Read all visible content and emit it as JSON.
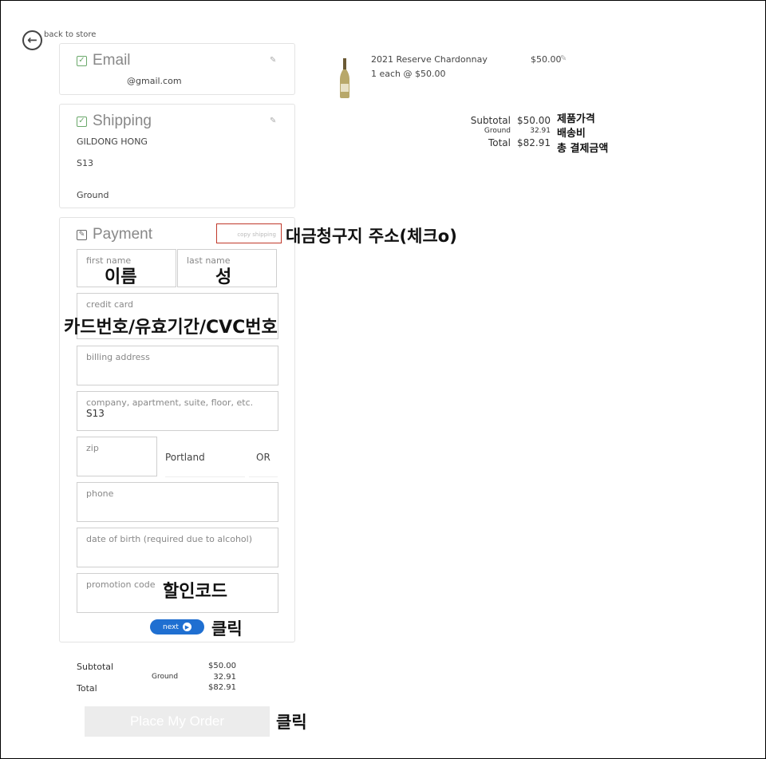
{
  "nav": {
    "back_label": "back to store"
  },
  "email": {
    "title": "Email",
    "value": "@gmail.com"
  },
  "shipping": {
    "title": "Shipping",
    "name": "GILDONG HONG",
    "address": "S13",
    "method": "Ground"
  },
  "payment": {
    "title": "Payment",
    "copy_shipping": "copy shipping",
    "first_name_label": "first name",
    "last_name_label": "last name",
    "credit_card_label": "credit card",
    "billing_address_label": "billing address",
    "company_label": "company, apartment, suite, floor, etc.",
    "company_value": "S13",
    "zip_label": "zip",
    "city_value": "Portland",
    "state_value": "OR",
    "phone_label": "phone",
    "dob_label": "date of birth (required due to alcohol)",
    "promo_label": "promotion code",
    "next_label": "next"
  },
  "product": {
    "name": "2021 Reserve Chardonnay",
    "price": "$50.00",
    "qty_line": "1 each @ $50.00"
  },
  "top_summary": {
    "subtotal_label": "Subtotal",
    "subtotal_value": "$50.00",
    "ground_label": "Ground",
    "ground_value": "32.91",
    "total_label": "Total",
    "total_value": "$82.91"
  },
  "bottom_summary": {
    "subtotal_label": "Subtotal",
    "subtotal_value": "$50.00",
    "ground_label": "Ground",
    "ground_value": "32.91",
    "total_label": "Total",
    "total_value": "$82.91"
  },
  "order_button": "Place My Order",
  "annotations": {
    "product_price": "제품가격",
    "shipping_fee": "배송비",
    "total_payment": "총 결제금액",
    "billing_address": "대금청구지 주소(체크o)",
    "first_name": "이름",
    "last_name": "성",
    "card_info": "카드번호/유효기간/CVC번호",
    "promo_code": "할인코드",
    "click_next": "클릭",
    "click_order": "클릭"
  },
  "colors": {
    "accent_blue": "#1f6fd1",
    "check_green": "#6aa86a",
    "highlight_red": "#c0392b"
  }
}
